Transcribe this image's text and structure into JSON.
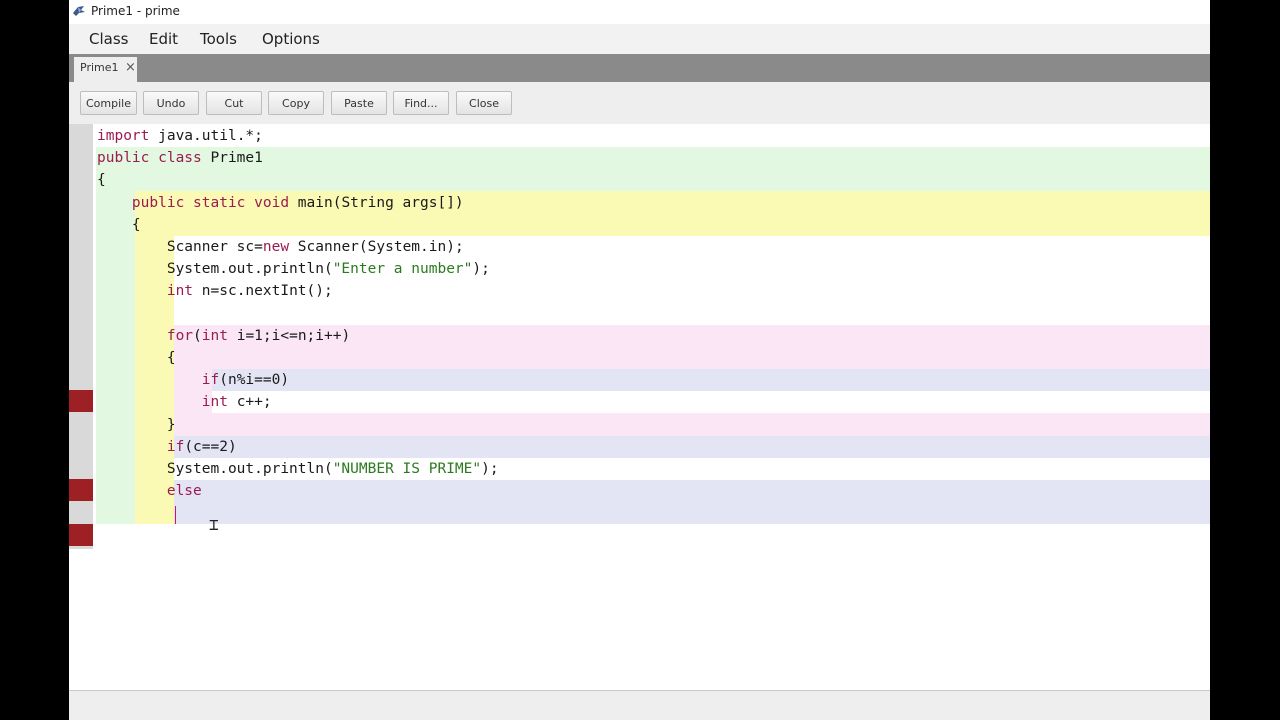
{
  "window": {
    "title": "Prime1 - prime",
    "icon": "bluej-bird-icon"
  },
  "menu": {
    "items": [
      "Class",
      "Edit",
      "Tools",
      "Options"
    ]
  },
  "tabs": [
    {
      "label": "Prime1",
      "close": "×"
    }
  ],
  "toolbar": {
    "buttons": [
      "Compile",
      "Undo",
      "Cut",
      "Copy",
      "Paste",
      "Find...",
      "Close"
    ]
  },
  "editor": {
    "scope_colors": {
      "class": "#e3f8e1",
      "method": "#fafab4",
      "loop": "#fae6f5",
      "if": "#e3e5f5",
      "plain": "#ffffff"
    },
    "gutter_marks": {
      "color": "#9d2124",
      "error_lines": [
        12,
        16,
        18
      ]
    },
    "lines": [
      {
        "segments": [
          {
            "t": "import",
            "c": "kw"
          },
          {
            "t": " java.util.*;"
          }
        ]
      },
      {
        "segments": [
          {
            "t": "public class",
            "c": "kw"
          },
          {
            "t": " Prime1"
          }
        ]
      },
      {
        "segments": [
          {
            "t": "{"
          }
        ]
      },
      {
        "segments": [
          {
            "t": "    "
          },
          {
            "t": "public static void",
            "c": "kw"
          },
          {
            "t": " main(String args[])"
          }
        ]
      },
      {
        "segments": [
          {
            "t": "    {"
          }
        ]
      },
      {
        "segments": [
          {
            "t": "        Scanner sc="
          },
          {
            "t": "new",
            "c": "kw"
          },
          {
            "t": " Scanner(System.in);"
          }
        ]
      },
      {
        "segments": [
          {
            "t": "        System.out.println("
          },
          {
            "t": "\"Enter a number\"",
            "c": "str"
          },
          {
            "t": ");"
          }
        ]
      },
      {
        "segments": [
          {
            "t": "        "
          },
          {
            "t": "int",
            "c": "kw"
          },
          {
            "t": " n=sc.nextInt();"
          }
        ]
      },
      {
        "segments": [
          {
            "t": ""
          }
        ]
      },
      {
        "segments": [
          {
            "t": "        "
          },
          {
            "t": "for",
            "c": "kw"
          },
          {
            "t": "("
          },
          {
            "t": "int",
            "c": "kw"
          },
          {
            "t": " i=1;i<=n;i++)"
          }
        ]
      },
      {
        "segments": [
          {
            "t": "        {"
          }
        ]
      },
      {
        "segments": [
          {
            "t": "            "
          },
          {
            "t": "if",
            "c": "kw"
          },
          {
            "t": "(n%i==0)"
          }
        ]
      },
      {
        "segments": [
          {
            "t": "            "
          },
          {
            "t": "int",
            "c": "kw"
          },
          {
            "t": " c++;"
          }
        ]
      },
      {
        "segments": [
          {
            "t": "        }"
          }
        ]
      },
      {
        "segments": [
          {
            "t": "        "
          },
          {
            "t": "if",
            "c": "kw"
          },
          {
            "t": "(c==2)"
          }
        ]
      },
      {
        "segments": [
          {
            "t": "        System.out.println("
          },
          {
            "t": "\"NUMBER IS PRIME\"",
            "c": "str"
          },
          {
            "t": ");"
          }
        ]
      },
      {
        "segments": [
          {
            "t": "        "
          },
          {
            "t": "else",
            "c": "kw"
          }
        ]
      },
      {
        "segments": [
          {
            "t": ""
          }
        ]
      }
    ]
  }
}
